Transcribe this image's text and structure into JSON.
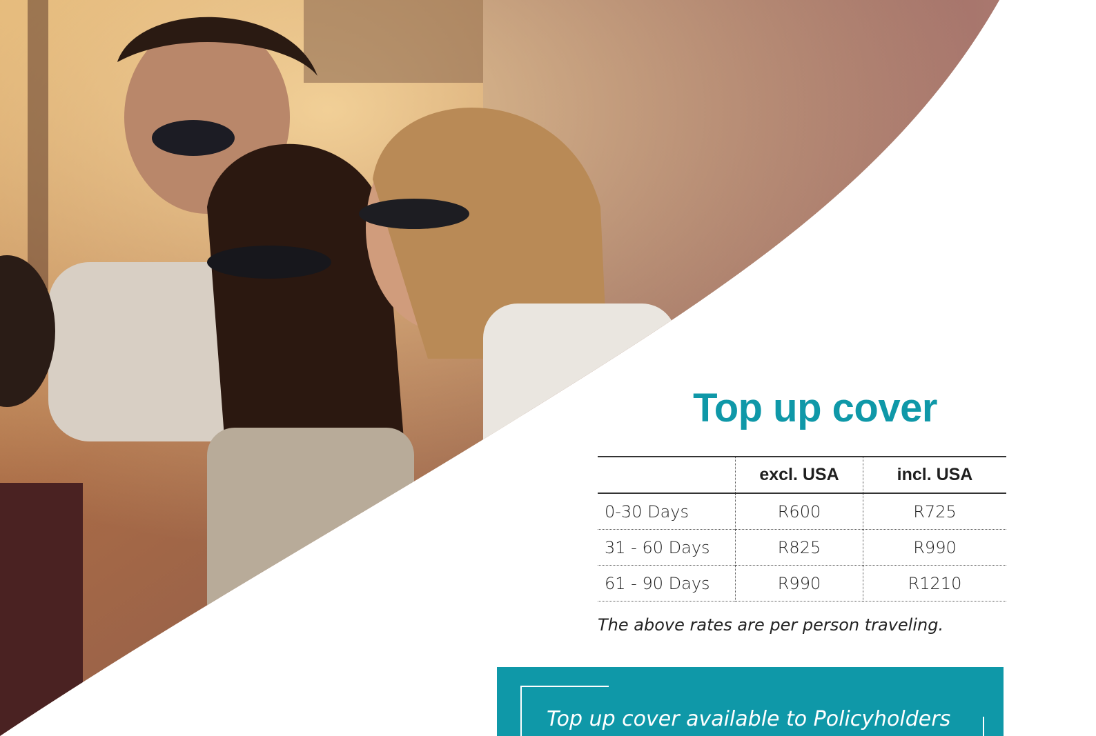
{
  "title": "Top up cover",
  "table": {
    "headers": [
      "",
      "excl. USA",
      "incl. USA"
    ],
    "rows": [
      {
        "period": "0-30 Days",
        "excl_usa": "R600",
        "incl_usa": "R725"
      },
      {
        "period": "31 - 60 Days",
        "excl_usa": "R825",
        "incl_usa": "R990"
      },
      {
        "period": "61 - 90 Days",
        "excl_usa": "R990",
        "incl_usa": "R1210"
      }
    ]
  },
  "note": "The above rates are per person traveling.",
  "banner": {
    "text": "Top up cover available to Policyholders"
  },
  "colors": {
    "accent": "#0f98a8",
    "text": "#222222"
  },
  "image": {
    "subject": "photo"
  }
}
